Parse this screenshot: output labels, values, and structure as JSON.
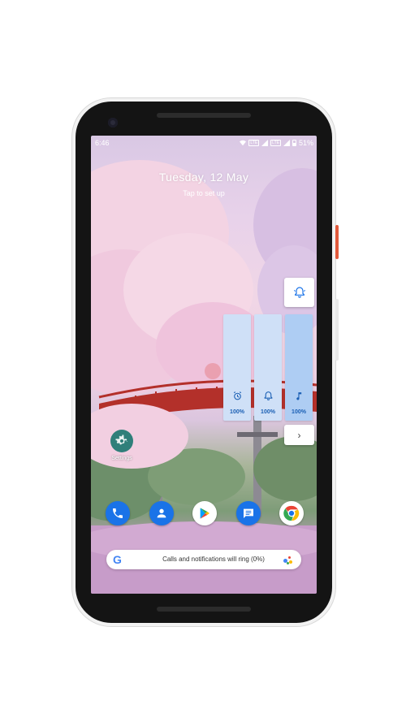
{
  "status": {
    "time": "6:46",
    "lte1": "LTE",
    "lte2": "LTE",
    "battery": "51%"
  },
  "lockscreen": {
    "date": "Tuesday, 12 May",
    "setup_text": "Tap to set up"
  },
  "volume_panel": {
    "sliders": [
      {
        "name": "alarm",
        "icon": "alarm-clock-icon",
        "percent": "100%",
        "level": 1.0
      },
      {
        "name": "ring",
        "icon": "bell-icon",
        "percent": "100%",
        "level": 1.0
      },
      {
        "name": "media",
        "icon": "music-note-icon",
        "percent": "100%",
        "level": 1.0
      }
    ],
    "expand_glyph": "›"
  },
  "apps": {
    "settings_label": "Settings"
  },
  "dock": [
    "phone-icon",
    "contacts-icon",
    "play-store-icon",
    "messages-icon",
    "chrome-icon"
  ],
  "searchbar": {
    "g": "G",
    "toast": "Calls and notifications will ring (0%)"
  },
  "colors": {
    "accent": "#1a73e8",
    "slider_bg": "#cfe0f7",
    "slider_fill": "#aecdf3"
  }
}
